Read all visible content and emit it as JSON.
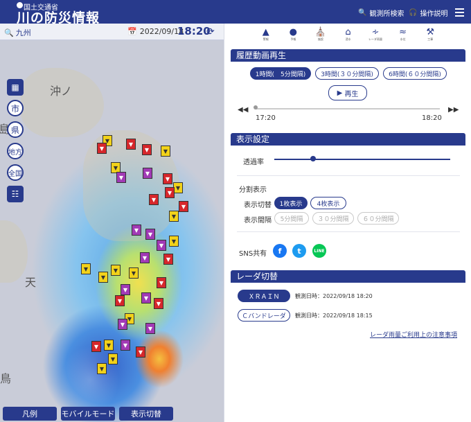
{
  "header": {
    "ministry": "国土交通省",
    "title": "川の防災情報",
    "station_search": "観測所検索",
    "manual": "操作説明"
  },
  "mapbar": {
    "search": "九州",
    "date": "2022/09/18",
    "time": "18:20"
  },
  "map": {
    "controls": [
      "市",
      "県",
      "地方",
      "全国"
    ],
    "places": [
      "沖ノ",
      "島",
      "天",
      "鳥"
    ],
    "bottom_buttons": [
      "凡例",
      "モバイルモード",
      "表示切替"
    ]
  },
  "toolbar": {
    "items": [
      "警報",
      "予報",
      "施設",
      "浸水",
      "レーダ雨量",
      "水位",
      "工事"
    ]
  },
  "history": {
    "title": "履歴動画再生",
    "ranges": [
      "1時間(　5分間隔)",
      "3時間(３０分間隔)",
      "6時間(６０分間隔)"
    ],
    "play": "再生",
    "start_time": "17:20",
    "end_time": "18:20"
  },
  "display": {
    "title": "表示設定",
    "opacity_label": "透過率",
    "opacity_value": 0.22,
    "split_label": "分割表示",
    "switch_label": "表示切替",
    "switch_options": [
      "1枚表示",
      "4枚表示"
    ],
    "interval_label": "表示間隔",
    "interval_options": [
      "5分間隔",
      "３０分間隔",
      "６０分間隔"
    ],
    "sns_label": "SNS共有",
    "sns": [
      "f",
      "t",
      "LINE"
    ]
  },
  "radar": {
    "title": "レーダ切替",
    "xrain_label": "ＸＲＡＩＮ",
    "xrain_time": "観測日時：2022/09/18 18:20",
    "cband_label": "Ｃバンドレーダ",
    "cband_time": "観測日時：2022/09/18 18:15",
    "notice": "レーダ雨量ご利用上の注意事項"
  },
  "colors": {
    "primary": "#283a8c",
    "facebook": "#1877f2",
    "twitter": "#1d9bf0",
    "line": "#06c755"
  }
}
